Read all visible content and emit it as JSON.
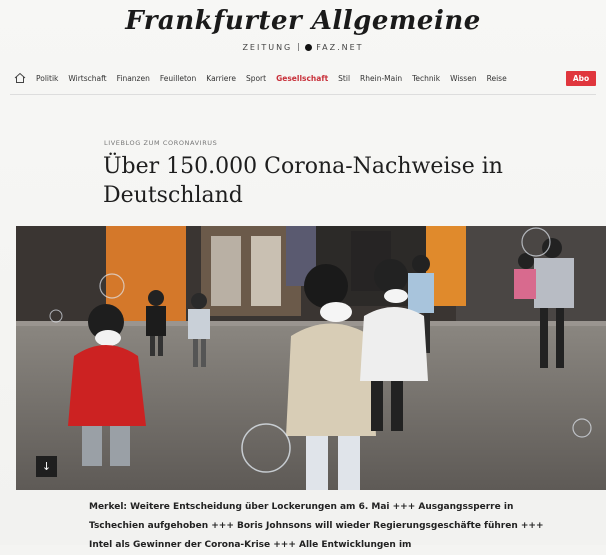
{
  "masthead": {
    "logo": "Frankfurter Allgemeine",
    "sub_left": "ZEITUNG",
    "sub_right": "FAZ.NET"
  },
  "nav": {
    "items": [
      "Politik",
      "Wirtschaft",
      "Finanzen",
      "Feuilleton",
      "Karriere",
      "Sport",
      "Gesellschaft",
      "Stil",
      "Rhein-Main",
      "Technik",
      "Wissen",
      "Reise"
    ],
    "active": "Gesellschaft",
    "abo_label": "Abo"
  },
  "article": {
    "kicker": "LIVEBLOG ZUM CORONAVIRUS",
    "headline": "Über 150.000 Corona-Nachweise in Deutschland",
    "photo_button": "↓",
    "teaser": "Merkel: Weitere Entscheidung über Lockerungen am 6. Mai +++ Ausgangssperre in Tschechien aufgehoben +++ Boris Johnsons will wieder Regierungsgeschäfte führen +++ Intel als Gewinner der Corona-Krise +++ Alle Entwicklungen im"
  },
  "colors": {
    "accent": "#c8303a",
    "abo_bg": "#e0363d"
  }
}
